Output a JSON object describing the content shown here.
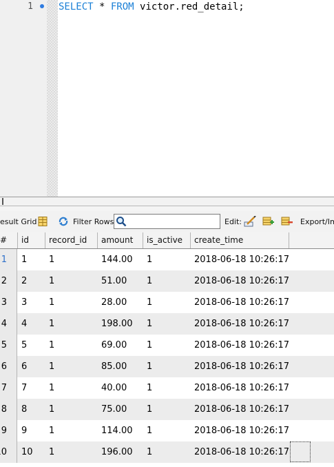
{
  "editor": {
    "line_number": "1",
    "code_keyword_select": "SELECT",
    "code_star": " * ",
    "code_keyword_from": "FROM",
    "code_rest": " victor.red_detail;"
  },
  "toolbar": {
    "result_grid_label": "esult Grid",
    "filter_rows_label": "Filter Rows:",
    "edit_label": "Edit:",
    "export_label": "Export/Im"
  },
  "grid": {
    "columns": [
      "#",
      "id",
      "record_id",
      "amount",
      "is_active",
      "create_time"
    ],
    "rows": [
      {
        "n": "1",
        "id": "1",
        "record_id": "1",
        "amount": "144.00",
        "is_active": "1",
        "create_time": "2018-06-18 10:26:17"
      },
      {
        "n": "2",
        "id": "2",
        "record_id": "1",
        "amount": "51.00",
        "is_active": "1",
        "create_time": "2018-06-18 10:26:17"
      },
      {
        "n": "3",
        "id": "3",
        "record_id": "1",
        "amount": "28.00",
        "is_active": "1",
        "create_time": "2018-06-18 10:26:17"
      },
      {
        "n": "4",
        "id": "4",
        "record_id": "1",
        "amount": "198.00",
        "is_active": "1",
        "create_time": "2018-06-18 10:26:17"
      },
      {
        "n": "5",
        "id": "5",
        "record_id": "1",
        "amount": "69.00",
        "is_active": "1",
        "create_time": "2018-06-18 10:26:17"
      },
      {
        "n": "6",
        "id": "6",
        "record_id": "1",
        "amount": "85.00",
        "is_active": "1",
        "create_time": "2018-06-18 10:26:17"
      },
      {
        "n": "7",
        "id": "7",
        "record_id": "1",
        "amount": "40.00",
        "is_active": "1",
        "create_time": "2018-06-18 10:26:17"
      },
      {
        "n": "8",
        "id": "8",
        "record_id": "1",
        "amount": "75.00",
        "is_active": "1",
        "create_time": "2018-06-18 10:26:17"
      },
      {
        "n": "9",
        "id": "9",
        "record_id": "1",
        "amount": "114.00",
        "is_active": "1",
        "create_time": "2018-06-18 10:26:17"
      },
      {
        "n": "10",
        "id": "10",
        "record_id": "1",
        "amount": "196.00",
        "is_active": "1",
        "create_time": "2018-06-18 10:26:17"
      }
    ]
  },
  "colors": {
    "keyword": "#1a7fd6",
    "bookmark_dot": "#2d7be0",
    "alt_row": "#ececec"
  }
}
